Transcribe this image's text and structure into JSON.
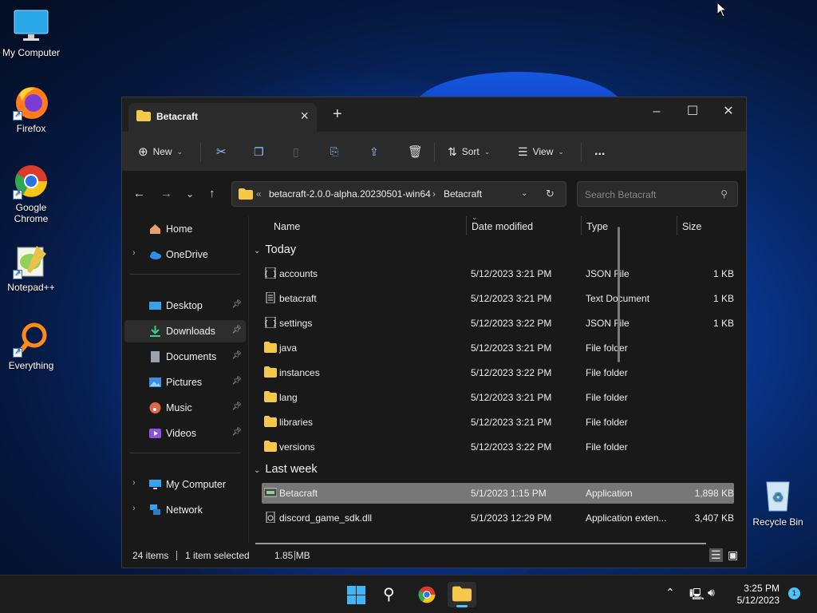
{
  "desktop": {
    "icons": [
      {
        "label": "My Computer"
      },
      {
        "label": "Firefox"
      },
      {
        "label": "Google Chrome"
      },
      {
        "label": "Notepad++"
      },
      {
        "label": "Everything"
      },
      {
        "label": "Recycle Bin"
      }
    ]
  },
  "window": {
    "tab_title": "Betacraft",
    "toolbar": {
      "new_label": "New",
      "sort_label": "Sort",
      "view_label": "View",
      "more_label": "..."
    },
    "address": {
      "overflow": "«",
      "segments": [
        "betacraft-2.0.0-alpha.20230501-win64",
        "Betacraft"
      ]
    },
    "search_placeholder": "Search Betacraft",
    "sidebar": {
      "items": [
        {
          "label": "Home"
        },
        {
          "label": "OneDrive"
        },
        {
          "label": "Desktop"
        },
        {
          "label": "Downloads"
        },
        {
          "label": "Documents"
        },
        {
          "label": "Pictures"
        },
        {
          "label": "Music"
        },
        {
          "label": "Videos"
        },
        {
          "label": "My Computer"
        },
        {
          "label": "Network"
        }
      ]
    },
    "columns": {
      "name": "Name",
      "date": "Date modified",
      "type": "Type",
      "size": "Size"
    },
    "groups": {
      "today": "Today",
      "last_week": "Last week"
    },
    "files": [
      {
        "name": "accounts",
        "date": "5/12/2023 3:21 PM",
        "type": "JSON File",
        "size": "1 KB"
      },
      {
        "name": "betacraft",
        "date": "5/12/2023 3:21 PM",
        "type": "Text Document",
        "size": "1 KB"
      },
      {
        "name": "settings",
        "date": "5/12/2023 3:22 PM",
        "type": "JSON File",
        "size": "1 KB"
      },
      {
        "name": "java",
        "date": "5/12/2023 3:21 PM",
        "type": "File folder",
        "size": ""
      },
      {
        "name": "instances",
        "date": "5/12/2023 3:22 PM",
        "type": "File folder",
        "size": ""
      },
      {
        "name": "lang",
        "date": "5/12/2023 3:21 PM",
        "type": "File folder",
        "size": ""
      },
      {
        "name": "libraries",
        "date": "5/12/2023 3:21 PM",
        "type": "File folder",
        "size": ""
      },
      {
        "name": "versions",
        "date": "5/12/2023 3:22 PM",
        "type": "File folder",
        "size": ""
      },
      {
        "name": "Betacraft",
        "date": "5/1/2023 1:15 PM",
        "type": "Application",
        "size": "1,898 KB"
      },
      {
        "name": "discord_game_sdk.dll",
        "date": "5/1/2023 12:29 PM",
        "type": "Application exten...",
        "size": "3,407 KB"
      }
    ],
    "status": {
      "count": "24 items",
      "selected": "1 item selected",
      "size": "1.85 MB"
    }
  },
  "taskbar": {
    "time": "3:25 PM",
    "date": "5/12/2023",
    "notification_count": "1"
  }
}
